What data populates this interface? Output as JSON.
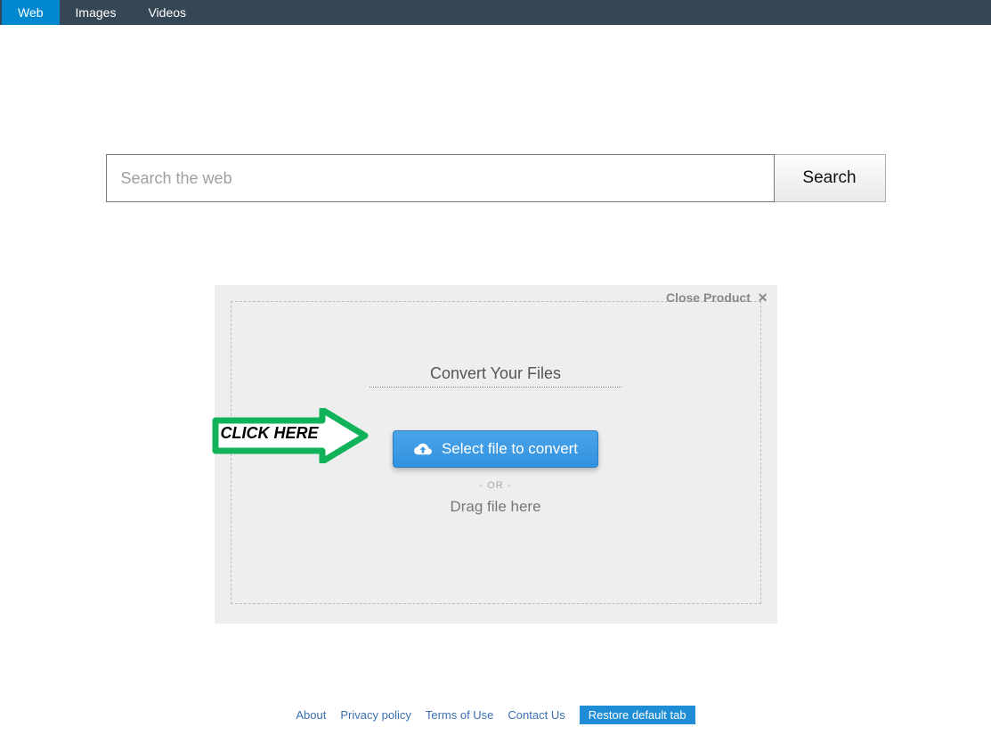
{
  "nav": {
    "tabs": [
      {
        "label": "Web",
        "active": true
      },
      {
        "label": "Images",
        "active": false
      },
      {
        "label": "Videos",
        "active": false
      }
    ]
  },
  "search": {
    "placeholder": "Search the web",
    "value": "",
    "button_label": "Search"
  },
  "widget": {
    "close_label": "Close Product",
    "title": "Convert Your Files",
    "select_button_label": "Select file to convert",
    "or_label": "- OR -",
    "drag_label": "Drag file here",
    "arrow_label": "CLICK HERE"
  },
  "footer": {
    "links": [
      {
        "label": "About"
      },
      {
        "label": "Privacy policy"
      },
      {
        "label": "Terms of Use"
      },
      {
        "label": "Contact Us"
      }
    ],
    "restore_label": "Restore default tab"
  }
}
